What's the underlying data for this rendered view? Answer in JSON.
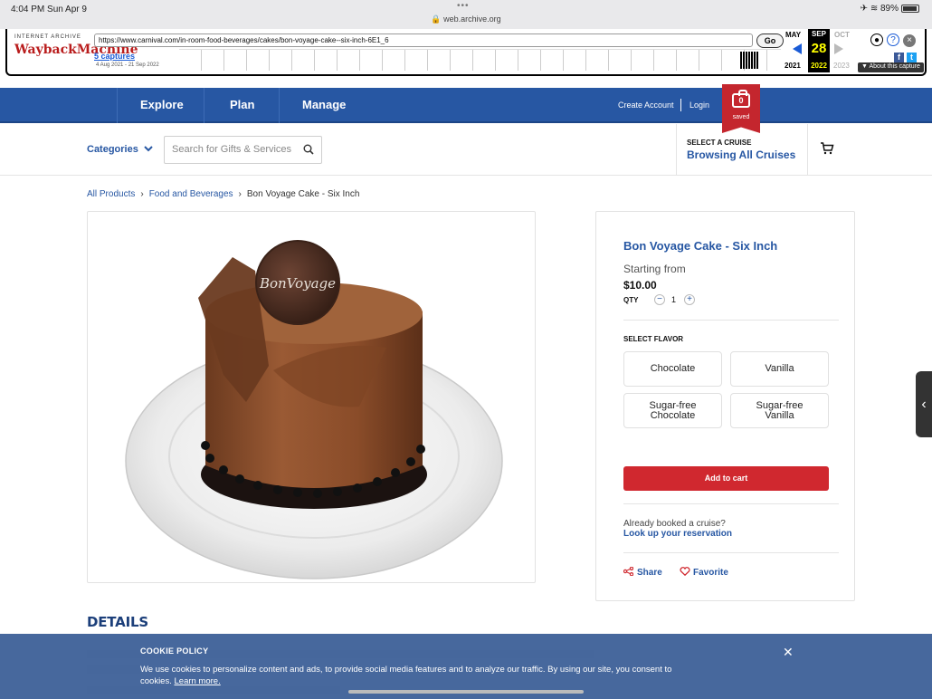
{
  "status_bar": {
    "time": "4:04 PM  Sun Apr 9",
    "dots": "•••",
    "url": "🔒 web.archive.org",
    "battery": "89%"
  },
  "wayback": {
    "logo_top": "INTERNET ARCHIVE",
    "logo": "WaybackMachine",
    "url": "https://www.carnival.com/in-room-food-beverages/cakes/bon-voyage-cake--six-inch-6E1_6",
    "go": "Go",
    "captures": "5 captures",
    "range": "4 Aug 2021 - 21 Sep 2022",
    "month_prev": "MAY",
    "month_cur": "SEP",
    "month_next": "OCT",
    "day": "28",
    "year_prev": "2021",
    "year_cur": "2022",
    "year_next": "2023",
    "about": "▼ About this capture"
  },
  "nav": {
    "explore": "Explore",
    "plan": "Plan",
    "manage": "Manage",
    "create_account": "Create Account",
    "login": "Login",
    "saved_count": "0",
    "saved_label": "saved"
  },
  "header": {
    "categories": "Categories",
    "search_placeholder": "Search for Gifts & Services",
    "select_cruise_label": "SELECT A CRUISE",
    "select_cruise_value": "Browsing All Cruises"
  },
  "breadcrumb": {
    "items": [
      "All Products",
      "Food and Beverages",
      "Bon Voyage Cake - Six Inch"
    ]
  },
  "product": {
    "cake_topper": "BonVoyage",
    "title": "Bon Voyage Cake - Six Inch",
    "starting_from": "Starting from",
    "price": "$10.00",
    "qty_label": "QTY",
    "qty_minus": "−",
    "qty_value": "1",
    "qty_plus": "+",
    "select_flavor": "SELECT FLAVOR",
    "flavors": [
      "Chocolate",
      "Vanilla",
      "Sugar-free Chocolate",
      "Sugar-free Vanilla"
    ],
    "add_to_cart": "Add to cart",
    "already_booked": "Already booked a cruise?",
    "lookup": "Look up your reservation",
    "share": "Share",
    "favorite": "Favorite"
  },
  "details": {
    "heading": "DETAILS"
  },
  "cookie": {
    "heading": "COOKIE POLICY",
    "message": "We use cookies to personalize content and ads, to provide social media features and to analyze our traffic. By using our site, you consent to cookies.",
    "learn_more": "Learn more.",
    "close": "✕"
  },
  "colors": {
    "brand_blue": "#2757a3",
    "cart_red": "#d0282f",
    "saved_red": "#c4262e"
  }
}
